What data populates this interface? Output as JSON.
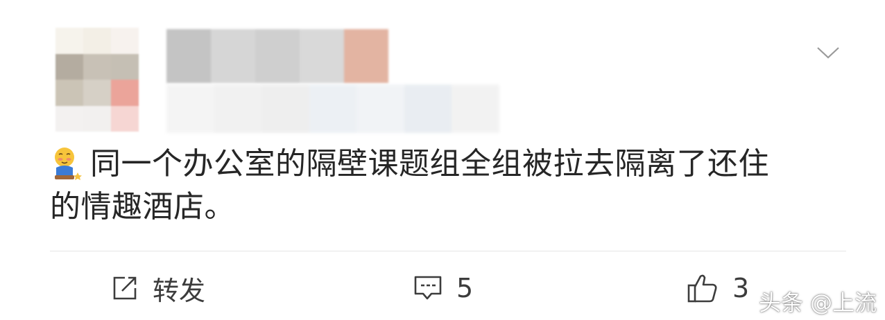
{
  "post": {
    "text_line1": "同一个办公室的隔壁课题组全组被拉去隔离了还住",
    "text_line2": "的情趣酒店。",
    "emoji": "shy-face-emoji"
  },
  "actions": {
    "repost_label": "转发",
    "comment_count": "5",
    "like_count": "3"
  },
  "watermark": "头条 @上流",
  "colors": {
    "text": "#262626",
    "icon": "#3c3c3c",
    "divider": "#e6e6e6"
  }
}
